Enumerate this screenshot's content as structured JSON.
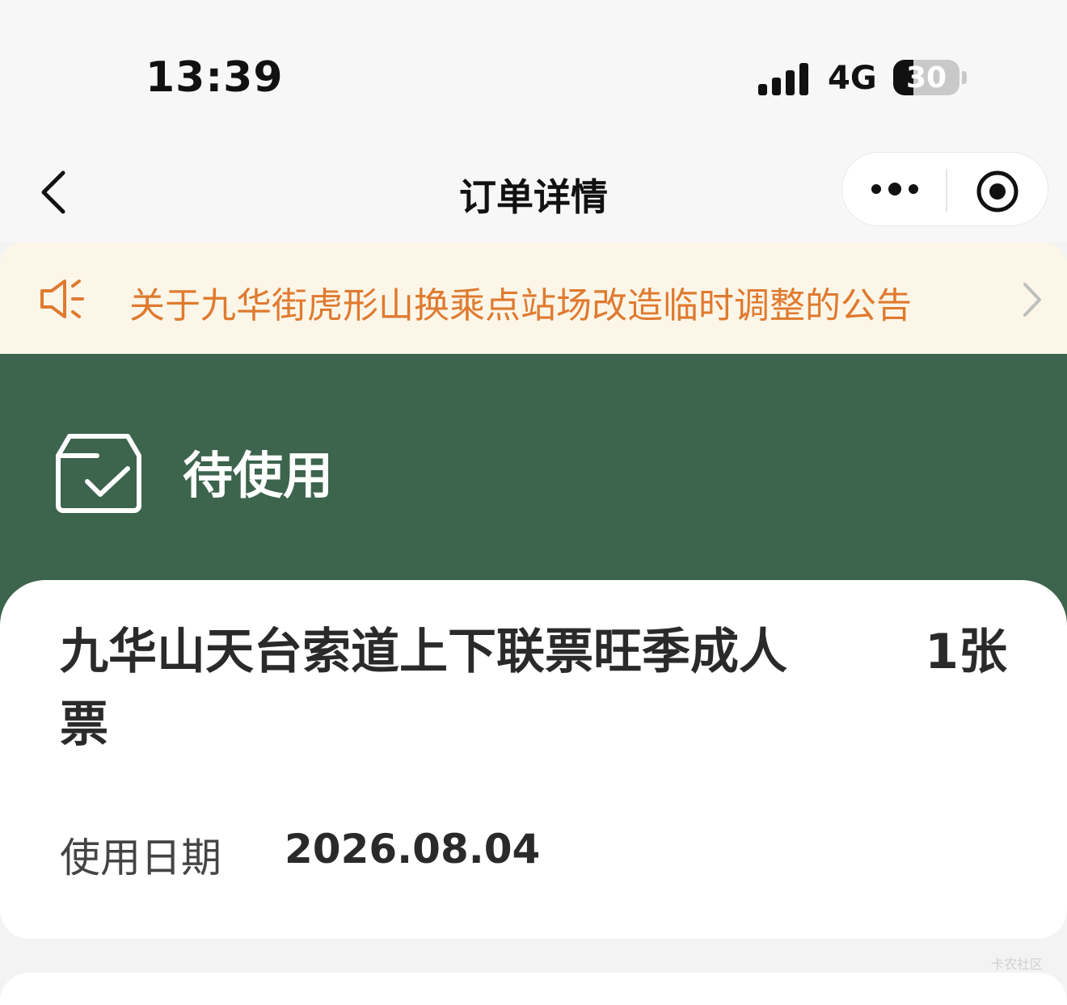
{
  "status_bar": {
    "time": "13:39",
    "network": "4G",
    "battery": "30",
    "battery_level": 0.3
  },
  "nav": {
    "title": "订单详情",
    "back_icon": "chevron-left-icon",
    "more_icon": "more-dots-icon",
    "close_icon": "target-circle-icon"
  },
  "notice": {
    "text": "关于九华街虎形山换乘点站场改造临时调整的公告",
    "icon": "speaker-icon"
  },
  "order_status": {
    "label": "待使用",
    "icon": "box-check-icon"
  },
  "ticket": {
    "title": "九华山天台索道上下联票旺季成人票",
    "quantity": "1张",
    "date_label": "使用日期",
    "date_value": "2026.08.04"
  },
  "watermark": "卡农社区",
  "colors": {
    "accent_green": "#3d644d",
    "notice_orange": "#e07a2f",
    "notice_bg": "#fbf6e8"
  }
}
